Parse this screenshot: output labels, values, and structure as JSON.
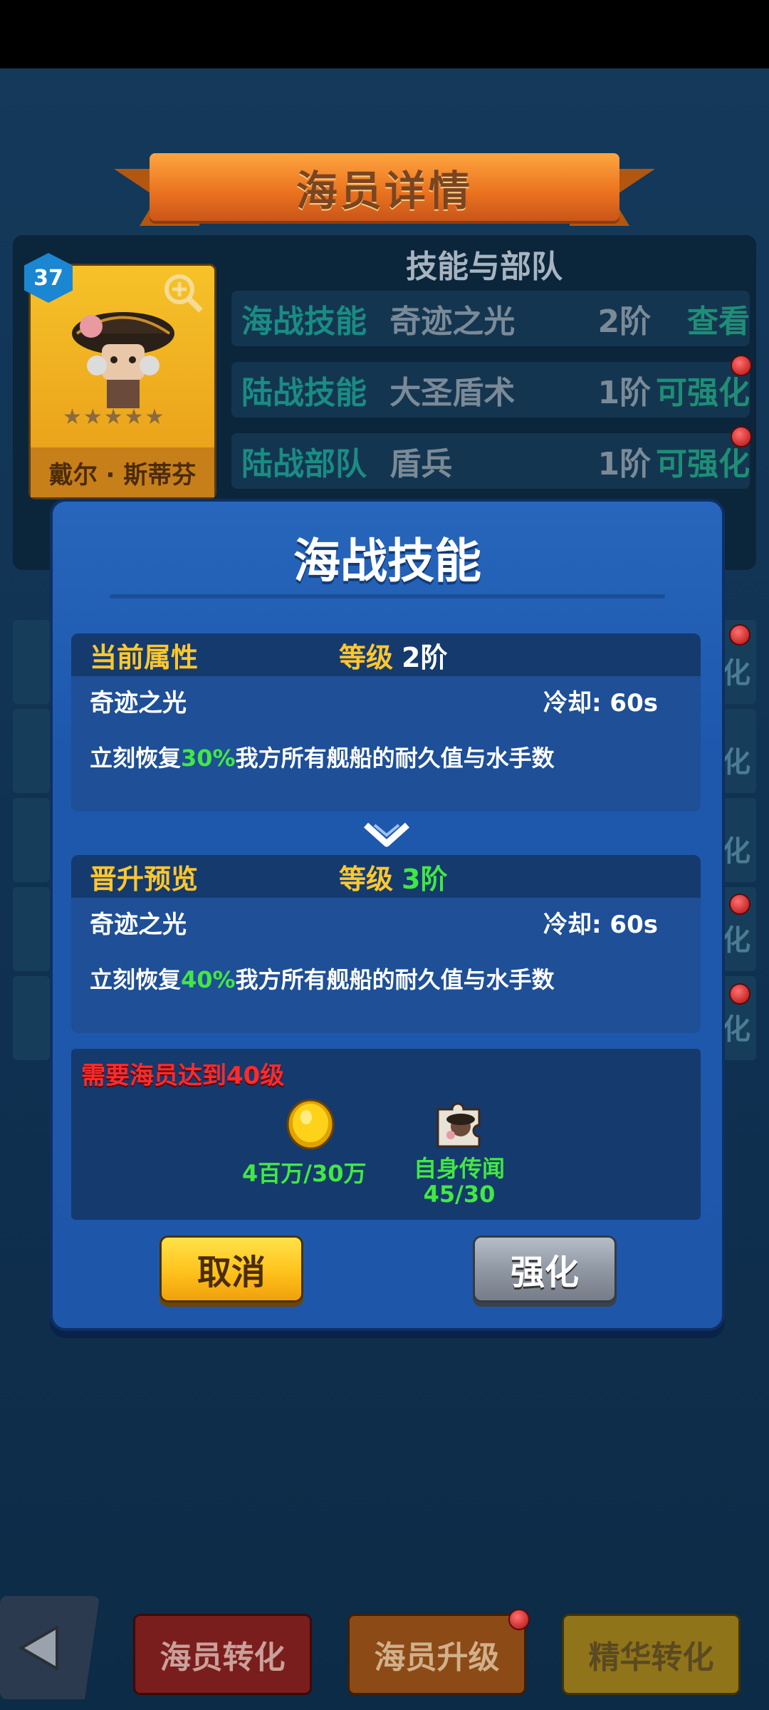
{
  "header": {
    "title": "海员详情"
  },
  "crew": {
    "level": "37",
    "name": "戴尔 · 斯蒂芬",
    "stars": "★★★★★"
  },
  "skills_panel": {
    "title": "技能与部队",
    "rows": [
      {
        "type": "海战技能",
        "name": "奇迹之光",
        "level": "2阶",
        "action": "查看"
      },
      {
        "type": "陆战技能",
        "name": "大圣盾术",
        "level": "1阶",
        "action": "可强化"
      },
      {
        "type": "陆战部队",
        "name": "盾兵",
        "level": "1阶",
        "action": "可强化"
      }
    ]
  },
  "side_list": {
    "right_label": "化"
  },
  "modal": {
    "title": "海战技能",
    "current": {
      "header": "当前属性",
      "level_label": "等级",
      "level_value": "2阶",
      "skill_name": "奇迹之光",
      "cooldown": "冷却: 60s",
      "desc_prefix": "立刻恢复",
      "desc_pct": "30%",
      "desc_suffix": "我方所有舰船的耐久值与水手数"
    },
    "preview": {
      "header": "晋升预览",
      "level_label": "等级",
      "level_value": "3阶",
      "skill_name": "奇迹之光",
      "cooldown": "冷却: 60s",
      "desc_prefix": "立刻恢复",
      "desc_pct": "40%",
      "desc_suffix": "我方所有舰船的耐久值与水手数"
    },
    "requirement": "需要海员达到40级",
    "costs": {
      "gold": "4百万/30万",
      "item_name": "自身传闻",
      "item_count": "45/30"
    },
    "buttons": {
      "cancel": "取消",
      "upgrade": "强化"
    }
  },
  "bottom_bar": {
    "convert": "海员转化",
    "upgrade": "海员升级",
    "essence": "精华转化"
  },
  "colors": {
    "accent_yellow": "#ffc72e",
    "green": "#41e842",
    "warning_red": "#ff2b2b",
    "modal_blue": "#1e57aa"
  }
}
